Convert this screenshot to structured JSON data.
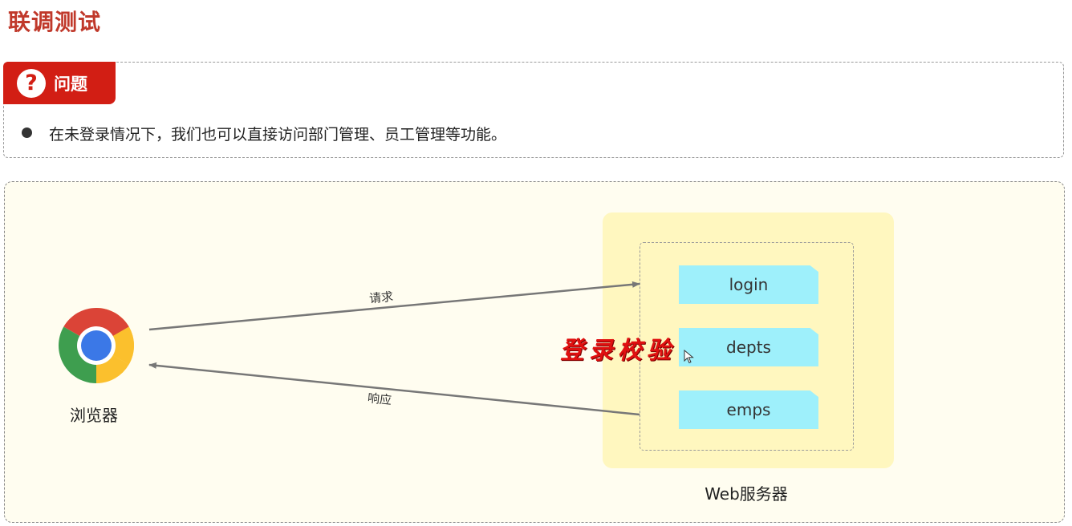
{
  "page": {
    "title": "联调测试"
  },
  "question": {
    "label": "问题",
    "icon": "question-icon",
    "text": "在未登录情况下，我们也可以直接访问部门管理、员工管理等功能。"
  },
  "diagram": {
    "browser": {
      "label": "浏览器",
      "icon": "chrome-icon"
    },
    "request_label": "请求",
    "response_label": "响应",
    "server": {
      "label": "Web服务器",
      "endpoints": [
        "login",
        "depts",
        "emps"
      ]
    },
    "annotation": "登录校验",
    "colors": {
      "title": "#c0392b",
      "question_header": "#d21e14",
      "server_panel": "#fff7bf",
      "endpoint": "#9ef0fb",
      "annotation": "#e01010",
      "arrow": "#777777"
    }
  }
}
